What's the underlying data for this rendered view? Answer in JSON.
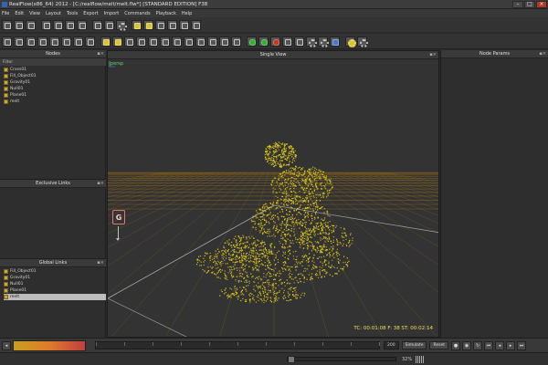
{
  "window": {
    "title": "RealFlow(x86_64) 2012 - [C:/realflow/melt/melt.flw*] [STANDARD EDITION] F38",
    "minimize": "–",
    "maximize": "□",
    "close": "×"
  },
  "menu": [
    "File",
    "Edit",
    "View",
    "Layout",
    "Tools",
    "Export",
    "Import",
    "Commands",
    "Playback",
    "Help"
  ],
  "panels": {
    "nodes": {
      "title": "Nodes",
      "filter_label": "Filter",
      "items": [
        "Cross01",
        "Fill_Object01",
        "Gravity01",
        "Null01",
        "Plane01",
        "melt"
      ]
    },
    "exclusive_links": {
      "title": "Exclusive Links"
    },
    "global_links": {
      "title": "Global Links",
      "items": [
        "Fill_Object01",
        "Gravity01",
        "Null01",
        "Plane01",
        "melt"
      ],
      "selected_index": 4
    },
    "viewport": {
      "title": "Single View",
      "camera": "persp",
      "gravity_label": "G",
      "timecode": "TC: 00:01:08  F: 38  ST: 00:02:14"
    },
    "node_params": {
      "title": "Node Params"
    }
  },
  "timeline": {
    "frame_box": "200",
    "mode": "Simulate",
    "reset": "Reset"
  },
  "status": {
    "zoom": "32%"
  },
  "colors": {
    "particles": "#e8d21a",
    "ground": "#b07a10",
    "accent_green": "#6cd36c"
  }
}
